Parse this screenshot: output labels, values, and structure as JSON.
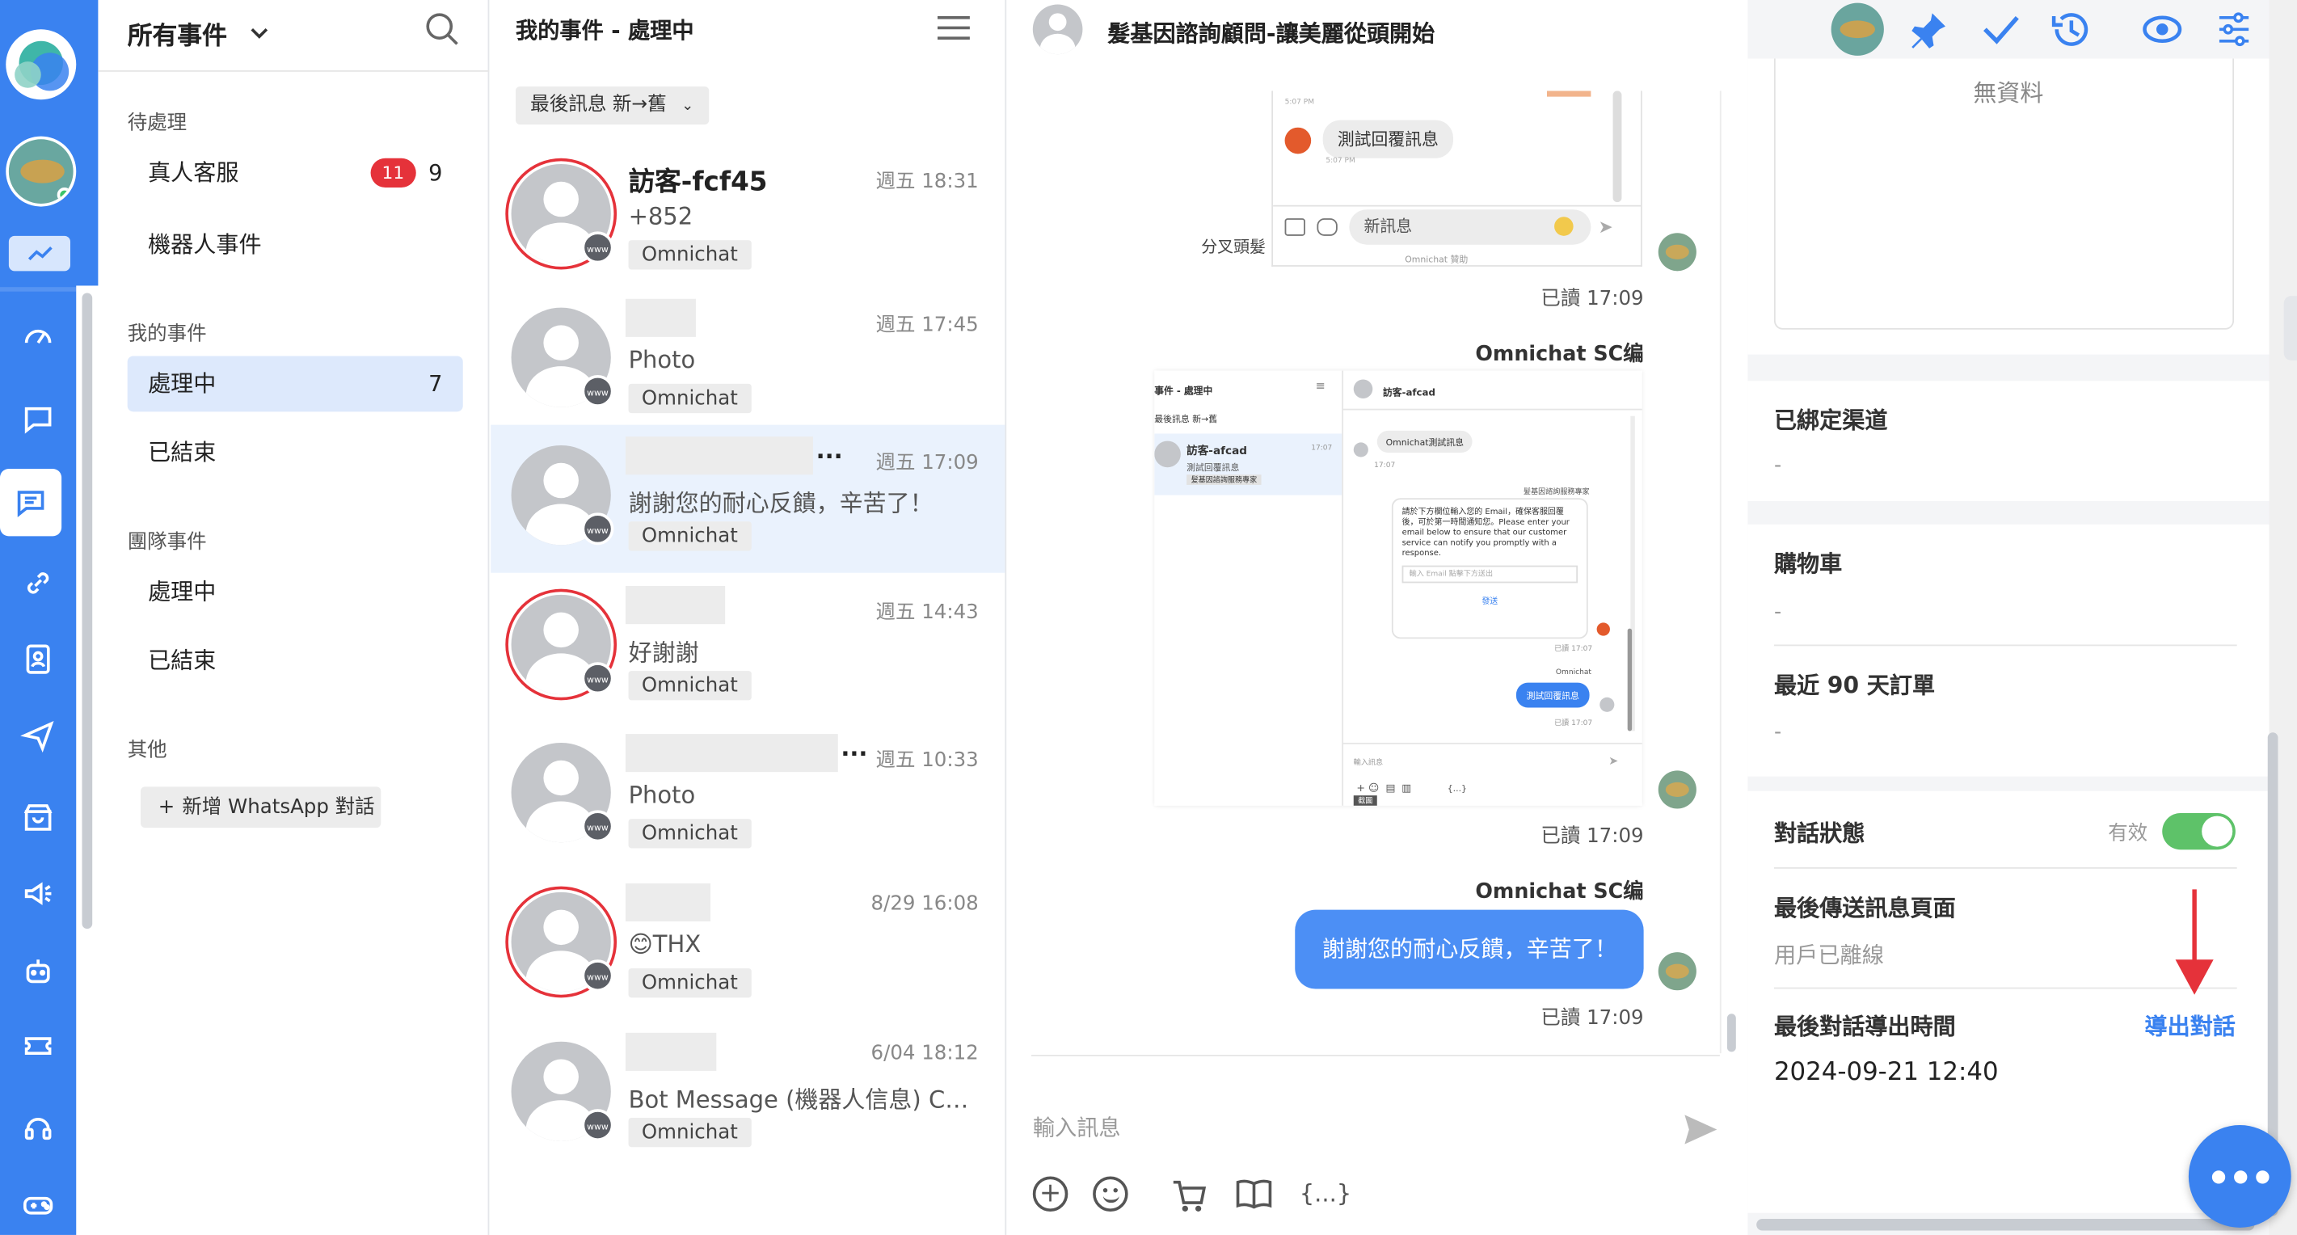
{
  "nav_rail": {
    "icons": [
      "logo-icon",
      "user-avatar",
      "analytics-icon",
      "dashboard-icon",
      "chat-icon",
      "chat-active-icon",
      "link-icon",
      "contacts-icon",
      "send-icon",
      "store-icon",
      "broadcast-icon",
      "bot-icon",
      "ticket-icon",
      "support-icon",
      "game-icon"
    ],
    "accent": "#3a82f0"
  },
  "events_panel": {
    "title": "所有事件",
    "pending_label": "待處理",
    "live_agent_label": "真人客服",
    "live_agent_badge": "11",
    "live_agent_count": "9",
    "bot_events_label": "機器人事件",
    "my_events_label": "我的事件",
    "my_processing_label": "處理中",
    "my_processing_count": "7",
    "my_closed_label": "已結束",
    "team_events_label": "團隊事件",
    "team_processing_label": "處理中",
    "team_closed_label": "已結束",
    "other_label": "其他",
    "add_whatsapp_label": "新增 WhatsApp 對話"
  },
  "conv_list": {
    "title": "我的事件 - 處理中",
    "sort_label": "最後訊息 新→舊",
    "items": [
      {
        "name": "訪客-fcf45",
        "time": "週五 18:31",
        "msg": "+852",
        "tag": "Omnichat",
        "unread": true
      },
      {
        "name": "",
        "time": "週五 17:45",
        "msg": "Photo",
        "tag": "Omnichat",
        "unread": false
      },
      {
        "name": "",
        "time": "週五 17:09",
        "msg": "謝謝您的耐心反饋，辛苦了！",
        "tag": "Omnichat",
        "unread": false
      },
      {
        "name": "",
        "time": "週五 14:43",
        "msg": "好謝謝",
        "tag": "Omnichat",
        "unread": true
      },
      {
        "name": "",
        "time": "週五 10:33",
        "msg": "Photo",
        "tag": "Omnichat",
        "unread": false
      },
      {
        "name": "",
        "time": "8/29 16:08",
        "msg": "😊THX",
        "tag": "Omnichat",
        "unread": true
      },
      {
        "name": "",
        "time": "6/04 18:12",
        "msg": "Bot Message (機器人信息) Carousel",
        "tag": "Omnichat",
        "unread": false
      }
    ]
  },
  "chat": {
    "title": "髮基因諮詢顧問-讓美麗從頭開始",
    "shot1": {
      "bubble": "測試回覆訊息",
      "input": "新訊息",
      "partial": "分叉頭髮",
      "footer": "Omnichat 贊助",
      "time": "5:07 PM"
    },
    "read_1": "已讀 17:09",
    "sender_2": "Omnichat SC编",
    "shot2": {
      "title": "事件 - 處理中",
      "sort": "最後訊息 新→舊",
      "visitor": "訪客-afcad",
      "item_msg": "測試回覆訊息",
      "item_tag": "髮基因諮詢服務專家",
      "item_time": "17:07",
      "header_name": "訪客-afcad",
      "bubble1": "Omnichat測試訊息",
      "t1": "17:07",
      "brand": "髮基因諮詢服務專家",
      "form_text": "請於下方欄位輸入您的 Email，確保客服回覆後，可於第一時間通知您。Please enter your email below to ensure that our customer service can notify you promptly with a response.",
      "email_ph": "輸入 Email 點擊下方送出",
      "send": "發送",
      "t2": "已讀 17:07",
      "omni": "Omnichat",
      "bubble2": "測試回覆訊息",
      "t3": "已讀 17:07",
      "input_ph": "輸入訊息",
      "tooltip": "截圖",
      "code": "{...}"
    },
    "read_2": "已讀 17:09",
    "sender_3": "Omnichat SC编",
    "bubble_3": "謝謝您的耐心反饋，辛苦了！",
    "read_3": "已讀 17:09",
    "input_placeholder": "輸入訊息",
    "code_label": "{...}"
  },
  "info_panel": {
    "no_data": "無資料",
    "bound_channel_label": "已綁定渠道",
    "bound_channel_value": "-",
    "cart_label": "購物車",
    "cart_value": "-",
    "orders_label": "最近 90 天訂單",
    "orders_value": "-",
    "status_label": "對話狀態",
    "status_value": "有效",
    "status_on": true,
    "last_page_label": "最後傳送訊息頁面",
    "last_page_value": "用戶已離線",
    "export_label": "最後對話導出時間",
    "export_link": "導出對話",
    "export_time": "2024-09-21 12:40",
    "toggle_color": "#5ec269",
    "arrow_color": "#e5323a"
  }
}
